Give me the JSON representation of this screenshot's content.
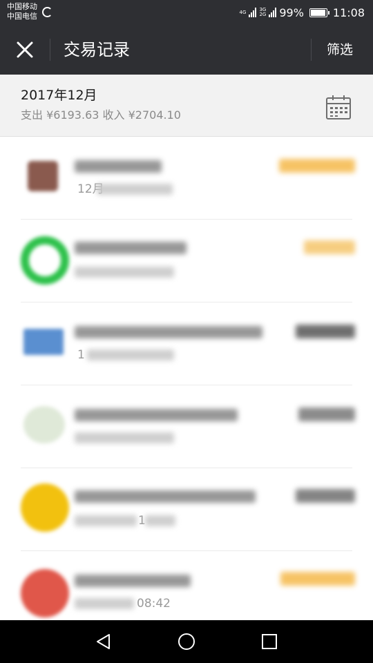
{
  "status_bar": {
    "carrier_1": "中国移动",
    "carrier_2": "中国电信",
    "net_1_top": "4G",
    "net_2_top": "3G",
    "net_2_bottom": "2G",
    "battery_percent": "99%",
    "battery_level": 0.99,
    "time": "11:08"
  },
  "header": {
    "title": "交易记录",
    "filter_label": "筛选",
    "close_icon": "close-icon"
  },
  "month_header": {
    "month": "2017年12月",
    "summary": "支出 ¥6193.63 收入 ¥2704.10",
    "calendar_icon": "calendar-icon"
  },
  "transactions": [
    {
      "avatar_color": "#8a5a4e",
      "avatar_shape": "square",
      "amount_color": "#f5b94a",
      "time_visible": "12月"
    },
    {
      "avatar_color": "#2ec14b",
      "avatar_shape": "ring",
      "amount_color": "#f5c56a",
      "time_visible": ""
    },
    {
      "avatar_color": "#5a8fd0",
      "avatar_shape": "card",
      "amount_color": "#555555",
      "time_visible": "1"
    },
    {
      "avatar_color": "#d8e6d2",
      "avatar_shape": "flat",
      "amount_color": "#777777",
      "time_visible": ""
    },
    {
      "avatar_color": "#f2c10f",
      "avatar_shape": "circle",
      "amount_color": "#6f6f6f",
      "time_visible": "1"
    },
    {
      "avatar_color": "#e0574a",
      "avatar_shape": "circle",
      "amount_color": "#f5b94a",
      "time_visible": "08:42"
    }
  ],
  "nav_bar": {
    "back_icon": "back-triangle-icon",
    "home_icon": "home-circle-icon",
    "recents_icon": "recents-square-icon"
  }
}
